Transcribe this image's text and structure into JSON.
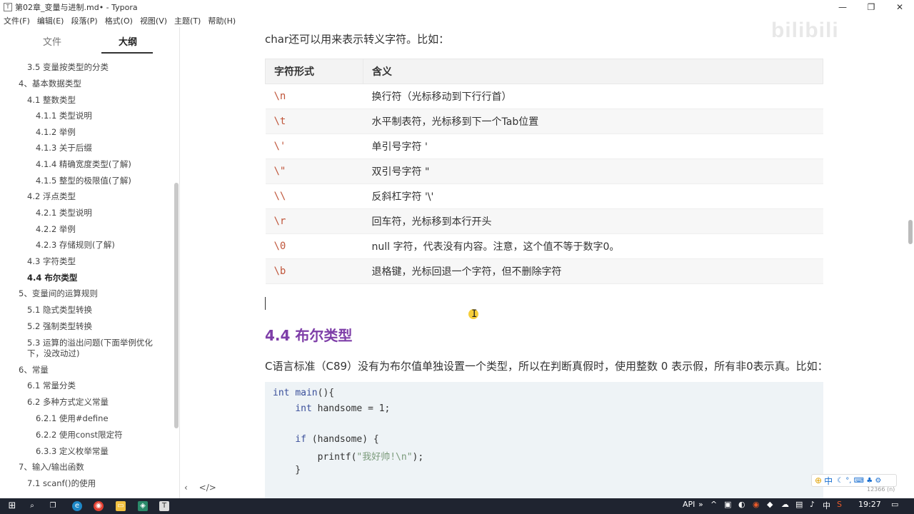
{
  "window": {
    "title": "第02章_变量与进制.md• - Typora",
    "controls": [
      "—",
      "❐",
      "✕"
    ]
  },
  "menu": [
    "文件(F)",
    "编辑(E)",
    "段落(P)",
    "格式(O)",
    "视图(V)",
    "主题(T)",
    "帮助(H)"
  ],
  "sidebar": {
    "tabs": [
      "文件",
      "大纲"
    ],
    "active_tab": "大纲",
    "outline": [
      "3.5 变量按类型的分类",
      "4、基本数据类型",
      "4.1 整数类型",
      "4.1.1 类型说明",
      "4.1.2 举例",
      "4.1.3 关于后缀",
      "4.1.4 精确宽度类型(了解)",
      "4.1.5 整型的极限值(了解)",
      "4.2 浮点类型",
      "4.2.1 类型说明",
      "4.2.2 举例",
      "4.2.3 存储规则(了解)",
      "4.3 字符类型",
      "4.4 布尔类型",
      "5、变量间的运算规则",
      "5.1 隐式类型转换",
      "5.2 强制类型转换",
      "5.3 运算的溢出问题(下面举例优化下，没改动过)",
      "6、常量",
      "6.1 常量分类",
      "6.2 多种方式定义常量",
      "6.2.1 使用#define",
      "6.2.2 使用const限定符",
      "6.3.3 定义枚举常量",
      "7、输入/输出函数",
      "7.1 scanf()的使用"
    ],
    "active_item": "4.4 布尔类型",
    "footer": [
      "‹",
      "</>"
    ]
  },
  "content": {
    "watermark": "bilibili",
    "intro": "char还可以用来表示转义字符。比如：",
    "table": {
      "headers": [
        "字符形式",
        "含义"
      ],
      "rows": [
        [
          "\\n",
          "换行符（光标移动到下行行首）"
        ],
        [
          "\\t",
          "水平制表符，光标移到下一个Tab位置"
        ],
        [
          "\\'",
          "单引号字符 '"
        ],
        [
          "\\\"",
          "双引号字符 \""
        ],
        [
          "\\\\",
          "反斜杠字符 '\\'"
        ],
        [
          "\\r",
          "回车符，光标移到本行开头"
        ],
        [
          "\\0",
          "null 字符，代表没有内容。注意，这个值不等于数字0。"
        ],
        [
          "\\b",
          "退格键，光标回退一个字符，但不删除字符"
        ]
      ]
    },
    "heading": "4.4 布尔类型",
    "para2": "C语言标准（C89）没有为布尔值单独设置一个类型，所以在判断真假时，使用整数 0 表示假，所有非0表示真。比如：",
    "code": [
      "int main(){",
      "    int handsome = 1;",
      "",
      "    if (handsome) {",
      "        printf(\"我好帅!\\n\");",
      "    }"
    ]
  },
  "ime": {
    "label": "中",
    "sub": "12366 (n)"
  },
  "taskbar": {
    "tray_text": "API",
    "lang": "中",
    "time": "19:27"
  }
}
